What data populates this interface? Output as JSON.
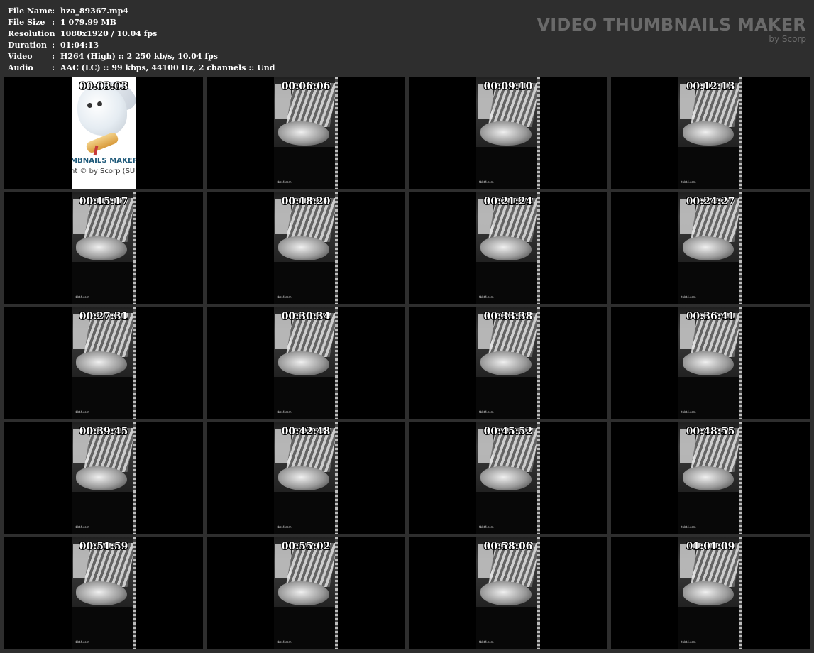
{
  "file_info": [
    {
      "label": "File Name",
      "value": "hza_89367.mp4"
    },
    {
      "label": "File Size",
      "value": "1 079.99 MB"
    },
    {
      "label": "Resolution",
      "value": "1080x1920 / 10.04 fps"
    },
    {
      "label": "Duration",
      "value": "01:04:13"
    },
    {
      "label": "Video",
      "value": "H264 (High) :: 2 250 kb/s, 10.04 fps"
    },
    {
      "label": "Audio",
      "value": "AAC (LC) :: 99 kbps, 44100 Hz, 2 channels :: Und"
    }
  ],
  "separator": ":",
  "brand": {
    "title": "VIDEO THUMBNAILS MAKER",
    "subtitle": "by Scorp"
  },
  "logo_frame": {
    "line1": "MBNAILS MAKER 8",
    "line2": "ht © by Scorp (SU"
  },
  "watermark": "tbbt4.com",
  "thumbnails": [
    {
      "timestamp": "00:03:03"
    },
    {
      "timestamp": "00:06:06"
    },
    {
      "timestamp": "00:09:10"
    },
    {
      "timestamp": "00:12:13"
    },
    {
      "timestamp": "00:15:17"
    },
    {
      "timestamp": "00:18:20"
    },
    {
      "timestamp": "00:21:24"
    },
    {
      "timestamp": "00:24:27"
    },
    {
      "timestamp": "00:27:31"
    },
    {
      "timestamp": "00:30:34"
    },
    {
      "timestamp": "00:33:38"
    },
    {
      "timestamp": "00:36:41"
    },
    {
      "timestamp": "00:39:45"
    },
    {
      "timestamp": "00:42:48"
    },
    {
      "timestamp": "00:45:52"
    },
    {
      "timestamp": "00:48:55"
    },
    {
      "timestamp": "00:51:59"
    },
    {
      "timestamp": "00:55:02"
    },
    {
      "timestamp": "00:58:06"
    },
    {
      "timestamp": "01:01:09"
    }
  ]
}
